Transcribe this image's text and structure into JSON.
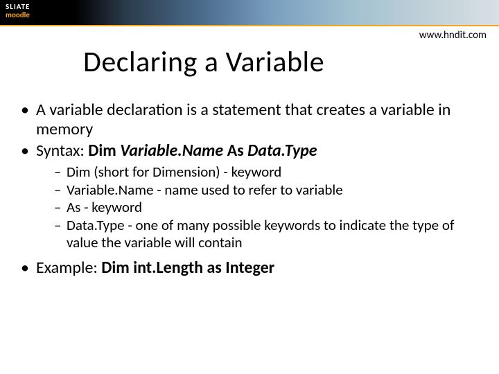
{
  "banner": {
    "logo_line1": "SLIATE",
    "logo_line2": "moodle"
  },
  "url": "www.hndit.com",
  "title": "Declaring a Variable",
  "bullets": [
    {
      "text": "A variable declaration is a statement that creates a variable in memory"
    },
    {
      "label": "Syntax:   ",
      "code_prefix": "Dim ",
      "code_varname": "Variable.Name",
      "code_mid": " As ",
      "code_datatype": "Data.Type",
      "sub": [
        "Dim (short for Dimension) - keyword",
        "Variable.Name - name used to refer to variable",
        "As - keyword",
        "Data.Type - one of many possible keywords to indicate the type of value the variable will contain"
      ]
    },
    {
      "label": "Example:   ",
      "example": "Dim int.Length as Integer"
    }
  ]
}
